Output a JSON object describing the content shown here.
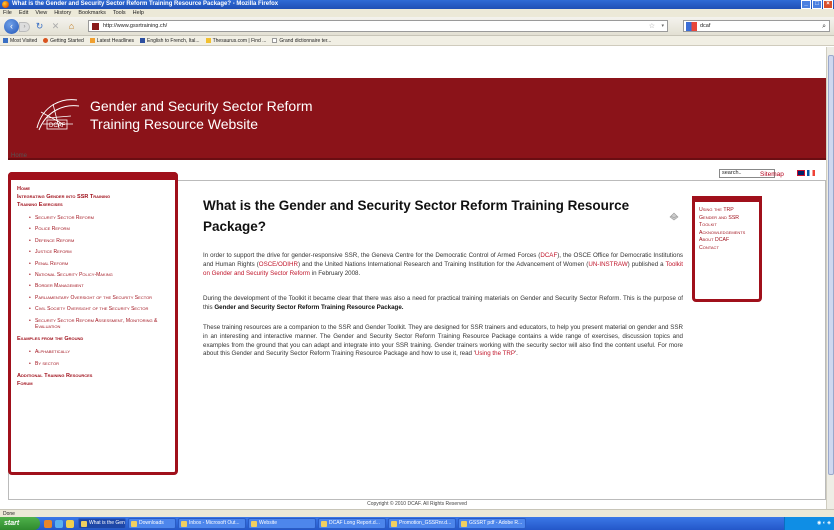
{
  "window": {
    "title": "What is the Gender and Security Sector Reform Training Resource Package? - Mozilla Firefox",
    "controls": [
      "_",
      "□",
      "×"
    ]
  },
  "menu": [
    "File",
    "Edit",
    "View",
    "History",
    "Bookmarks",
    "Tools",
    "Help"
  ],
  "toolbar": {
    "url": "http://www.gssrtraining.ch/",
    "search_engine_text": "dcaf",
    "icons": [
      "back-icon",
      "forward-icon",
      "reload-icon",
      "stop-icon",
      "home-icon",
      "star-icon",
      "search-icon"
    ]
  },
  "bookmarks": [
    "Most Visited",
    "Getting Started",
    "Latest Headlines",
    "English to French, Ital...",
    "Thesaurus.com | Find ...",
    "Grand dictionnaire ter..."
  ],
  "banner": {
    "line1": "Gender and Security Sector Reform",
    "line2": "Training Resource Website"
  },
  "breadcrumb": "Home",
  "search_placeholder": "search..",
  "sitemap": "Sitemap",
  "sidebar": {
    "home": "Home",
    "integrating": "Integrating Gender into SSR Training",
    "training_exercises": "Training Exercises",
    "exercise_items": [
      "Security Sector Reform",
      "Police Reform",
      "Defence Reform",
      "Justice Reform",
      "Penal Reform",
      "National Security Policy-Making",
      "Border Management",
      "Parliamentary Oversight of the Security Sector",
      "Civil Society Oversight of the Security Sector",
      "Security Sector Reform Assessment, Monitoring & Evaluation"
    ],
    "examples": "Examples from the Ground",
    "example_items": [
      "Alphabetically",
      "By sector"
    ],
    "additional": "Additional Training Resources",
    "forum": "Forum"
  },
  "main": {
    "title": "What is the Gender and Security Sector Reform Training Resource Package?",
    "p1_a": "In order to support the drive for gender-responsive SSR, the Geneva Centre for the Democratic Control of Armed Forces (",
    "p1_dcaf": "DCAF",
    "p1_b": "), the OSCE Office for Democratic Institutions and Human Rights (",
    "p1_osce": "OSCE/ODIHR",
    "p1_c": ") and the United Nations International Research and Training Institution for the Advancement of Women (",
    "p1_unin": "UN-INSTRAW",
    "p1_d": ") published a ",
    "p1_toolkit": "Toolkit on Gender and Security Sector Reform",
    "p1_e": " in February 2008.",
    "p2_a": "During the development of the Toolkit it became clear that there was also a need for practical training materials on Gender and Security Sector Reform. This is the purpose of this ",
    "p2_bold": "Gender and Security Sector Reform Training Resource Package.",
    "p3_a": "These training resources are a companion to the SSR and Gender Toolkit. They are designed for SSR trainers and educators, to help you present material on gender and SSR in an interesting and interactive manner. The Gender and Security Sector Reform Training Resource Package contains a wide range of exercises, discussion topics and examples from the ground that you can adapt and integrate into your SSR training. Gender trainers working with the security sector will also find the content useful. For more about this Gender and Security Sector Reform Training Resource Package and how to use it, read '",
    "p3_link": "Using the TRP",
    "p3_b": "'."
  },
  "rightbox": [
    "Using the TRP",
    "Gender and SSR Toolkit",
    "Acknowledgements",
    "About DCAF",
    "Contact"
  ],
  "footer": "Copyright © 2010 DCAF. All Rights Reserved",
  "status": "Done",
  "taskbar": {
    "start": "start",
    "tasks": [
      "What is the Gender...",
      "Downloads",
      "Inbox - Microsoft Out...",
      "Website",
      "DCAF Long Report.d...",
      "Promotion_GSSRnr.d...",
      "GSSRT pdf - Adobe R..."
    ]
  }
}
